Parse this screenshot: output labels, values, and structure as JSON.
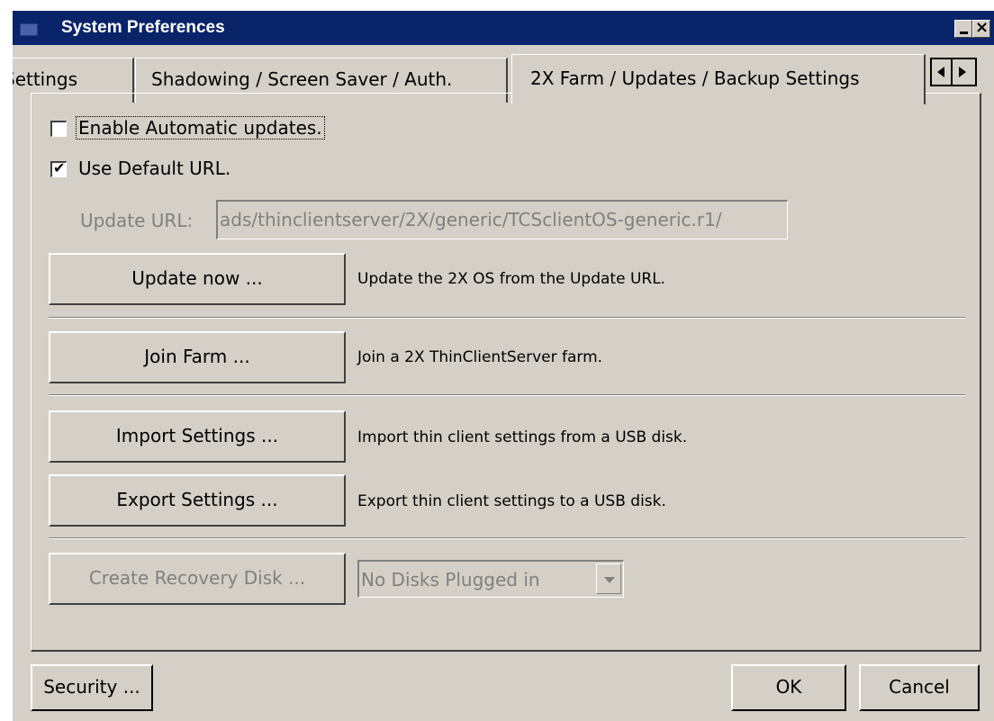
{
  "window": {
    "title": "System Preferences"
  },
  "tabs": [
    {
      "label": "Settings",
      "visible_label": "Settings"
    },
    {
      "label": "Shadowing / Screen Saver / Auth."
    },
    {
      "label": "2X Farm / Updates /  Backup Settings",
      "selected": true
    }
  ],
  "updates": {
    "enable_auto_label": "Enable Automatic updates.",
    "enable_auto_checked": false,
    "use_default_url_label": "Use Default URL.",
    "use_default_url_checked": true,
    "update_url_label": "Update URL:",
    "update_url_value": "ads/thinclientserver/2X/generic/TCSclientOS-generic.r1/",
    "update_now_button": "Update now ...",
    "update_now_desc": "Update the 2X OS from the Update URL."
  },
  "farm": {
    "join_button": "Join Farm ...",
    "join_desc": "Join a 2X ThinClientServer farm."
  },
  "backup": {
    "import_button": "Import Settings ...",
    "import_desc": "Import thin client settings from a USB disk.",
    "export_button": "Export Settings ...",
    "export_desc": "Export thin client settings to a USB disk.",
    "recovery_button": "Create Recovery Disk ...",
    "disk_select_value": "No Disks Plugged in"
  },
  "footer": {
    "security_button": "Security ...",
    "ok_button": "OK",
    "cancel_button": "Cancel"
  },
  "colors": {
    "titlebar": "#0a246a",
    "face": "#d4d0c8",
    "disabled_text": "#808080"
  }
}
